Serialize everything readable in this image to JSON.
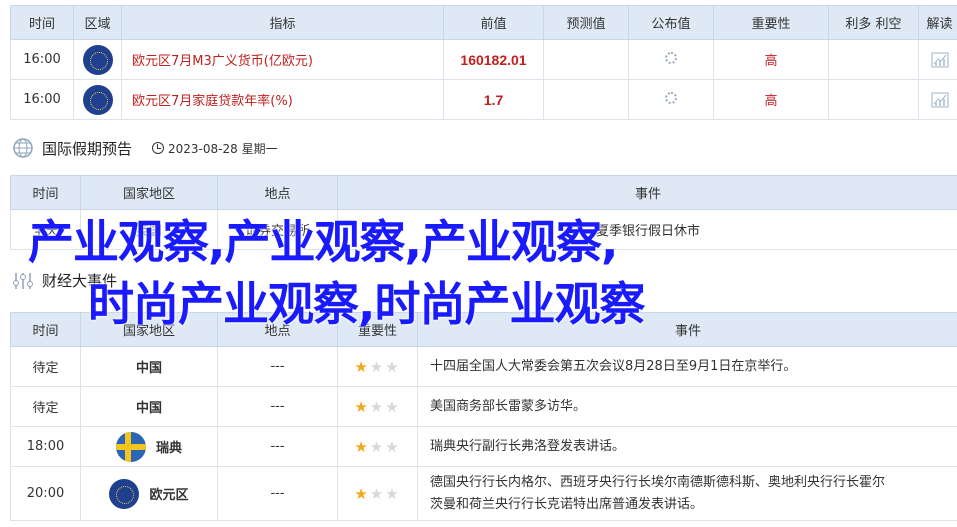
{
  "table1": {
    "headers": [
      "时间",
      "区域",
      "指标",
      "前值",
      "预测值",
      "公布值",
      "重要性",
      "利多 利空",
      "解读"
    ],
    "rows": [
      {
        "time": "16:00",
        "indicator": "欧元区7月M3广义货币(亿欧元)",
        "previous": "160182.01",
        "forecast": "",
        "actual": "",
        "importance": "高"
      },
      {
        "time": "16:00",
        "indicator": "欧元区7月家庭贷款年率(%)",
        "previous": "1.7",
        "forecast": "",
        "actual": "",
        "importance": "高"
      }
    ]
  },
  "holiday_section": {
    "title": "国际假期预告",
    "date": "2023-08-28 星期一"
  },
  "table2": {
    "headers": [
      "时间",
      "国家地区",
      "地点",
      "事件"
    ],
    "rows": [
      {
        "time": "全天",
        "region": "英国",
        "place": "证券交易所",
        "event": "夏季银行假日休市"
      }
    ]
  },
  "events_section": {
    "title": "财经大事件"
  },
  "table3": {
    "headers": [
      "时间",
      "国家地区",
      "地点",
      "重要性",
      "事件"
    ],
    "rows": [
      {
        "time": "待定",
        "region": "中国",
        "place": "---",
        "stars": 1,
        "event": "十四届全国人大常委会第五次会议8月28日至9月1日在京举行。"
      },
      {
        "time": "待定",
        "region": "中国",
        "place": "---",
        "stars": 1,
        "event": "美国商务部长雷蒙多访华。"
      },
      {
        "time": "18:00",
        "region": "瑞典",
        "place": "---",
        "stars": 1,
        "event": "瑞典央行副行长弗洛登发表讲话。"
      },
      {
        "time": "20:00",
        "region": "欧元区",
        "place": "---",
        "stars": 1,
        "event_line1": "德国央行行长内格尔、西班牙央行行长埃尔南德斯德科斯、奥地利央行行长霍尔",
        "event_line2": "茨曼和荷兰央行行长克诺特出席普通发表讲话。"
      }
    ]
  },
  "overlay": {
    "line1": "产业观察,产业观察,产业观察,",
    "line2": "时尚产业观察,时尚产业观察"
  },
  "colors": {
    "header_bg": "#dfe9f6",
    "accent_red": "#c0201f",
    "overlay_blue": "#1a1aff",
    "star": "#f0a81c"
  },
  "icons": {
    "flag_eu": "eu-flag-icon",
    "flag_se": "sweden-flag-icon",
    "globe": "globe-icon",
    "clock": "clock-icon",
    "analysis": "chart-analysis-icon",
    "pending": "loading-spinner-icon"
  }
}
